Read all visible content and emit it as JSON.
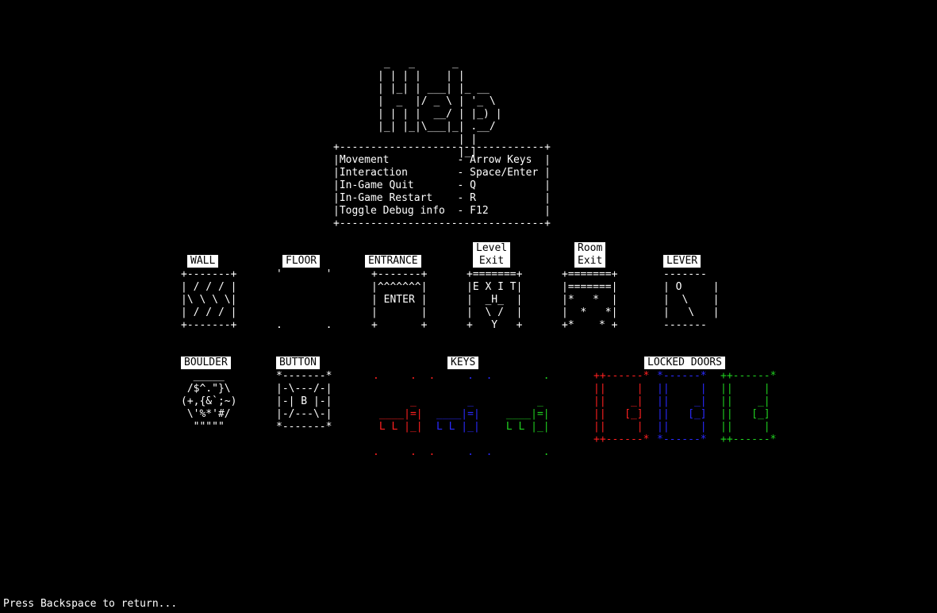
{
  "title_art": " _   _      _\n| | | |    | |\n| |_| | ___| |_ __\n|  _  |/ _ \\ | '_ \\\n| | | |  __/ | |_) |\n|_| |_|\\___|_| .__/\n             | |\n             |_|",
  "controls_box": "+---------------------------------+\n|Movement           - Arrow Keys  |\n|Interaction        - Space/Enter |\n|In-Game Quit       - Q           |\n|In-Game Restart    - R           |\n|Toggle Debug info  - F12         |\n+---------------------------------+",
  "tiles": {
    "wall": {
      "label": "WALL",
      "art": "+-------+\n| / / / |\n|\\ \\ \\ \\|\n| / / / |\n+-------+"
    },
    "floor": {
      "label": "FLOOR",
      "art": "'       '\n\n\n\n.       ."
    },
    "entrance": {
      "label": "ENTRANCE",
      "art": "+-------+\n|^^^^^^^|\n| ENTER |\n|       |\n+       +"
    },
    "level_exit": {
      "label": "Level\nExit",
      "art": "+=======+\n|E X I T|\n|  _H_  |\n|  \\ /  |\n+   Y   +"
    },
    "room_exit": {
      "label": "Room\nExit",
      "art": "+=======+\n|=======|\n|*   *  |\n|  *   *|\n+*    * +"
    },
    "lever": {
      "label": "LEVER",
      "art": "-------\n| O     |\n|  \\    |\n|   \\   |\n-------"
    },
    "boulder": {
      "label": "BOULDER",
      "art": "  _____\n /$^.\"}\\\n(+,{&`;~)\n \\'%*'#/\n  \"\"\"\"\""
    },
    "button": {
      "label": "BUTTON",
      "art": "*-------*\n|-\\---/-|\n|-| B |-|\n|-/---\\-|\n*-------*"
    }
  },
  "keys": {
    "label": "KEYS",
    "red": ".     .  .\n\n      _\n ____|=|\n L L |_|\n\n.     .  .",
    "blue": "     .  .\n\n     _\n____|=|\nL L |_|\n\n     .  .",
    "green": "       .\n\n      _\n ____|=|\n L L |_|\n\n       ."
  },
  "locked_doors": {
    "label": "LOCKED DOORS",
    "red": "++------*\n||     |\n||    _|\n||   [_]\n||     |\n++------*",
    "blue": "*------*\n||     |\n||    _|\n||   [_]\n||     |\n*------*",
    "green": "++------*\n||     |\n||    _|\n||   [_]\n||     |\n++------*"
  },
  "colors": {
    "background": "#000000",
    "text": "#ffffff",
    "red": "#ff2020",
    "blue": "#2a2aff",
    "green": "#20d020"
  },
  "footer": "Press Backspace to return..."
}
